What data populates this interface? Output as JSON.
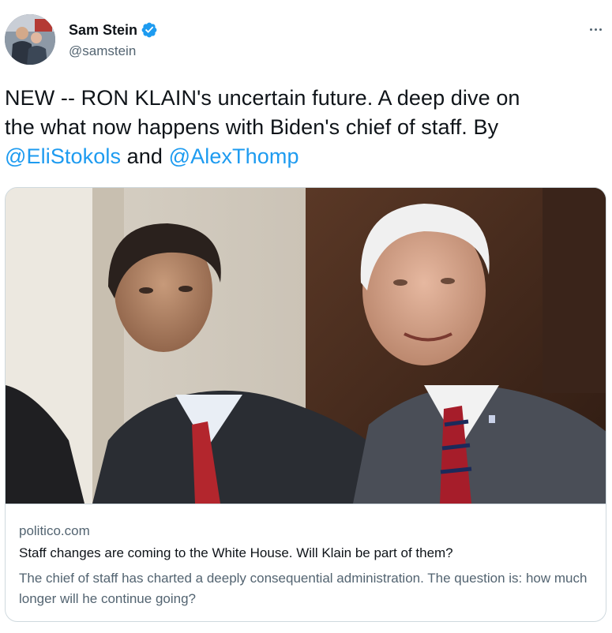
{
  "tweet": {
    "author": {
      "display_name": "Sam Stein",
      "handle": "@samstein",
      "verified": true,
      "avatar_icon": "profile-photo"
    },
    "more_icon": "more-horizontal-icon",
    "text": {
      "line1": "NEW -- RON KLAIN's uncertain future. A deep dive on",
      "line2": "the what now happens with Biden's chief of staff. By",
      "mention1": "@EliStokols",
      "connector": " and ",
      "mention2": "@AlexThomp"
    },
    "card": {
      "image_icon": "article-photo",
      "domain": "politico.com",
      "title": "Staff changes are coming to the White House. Will Klain be part of them?",
      "description": "The chief of staff has charted a deeply consequential administration. The question is: how much longer will he continue going?"
    }
  },
  "colors": {
    "accent": "#1d9bf0",
    "text_primary": "#0f1419",
    "text_secondary": "#536471",
    "border": "#cfd9de"
  }
}
